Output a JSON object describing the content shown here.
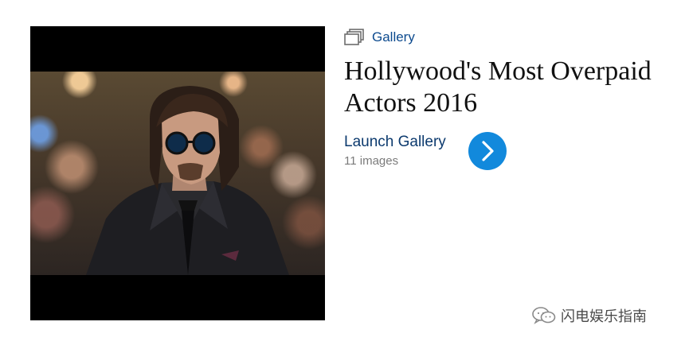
{
  "card": {
    "tag": "Gallery",
    "icon": "gallery-stack-icon",
    "title": "Hollywood's Most Overpaid Actors 2016",
    "launch_label": "Launch Gallery",
    "count_label": "11 images",
    "launch_button_icon": "chevron-right-icon",
    "image_alt": ""
  },
  "watermark": {
    "icon": "wechat-icon",
    "text": "闪电娱乐指南"
  },
  "colors": {
    "link": "#0c4a8e",
    "button": "#1289dc",
    "muted": "#7b7b7b",
    "title": "#111111"
  }
}
